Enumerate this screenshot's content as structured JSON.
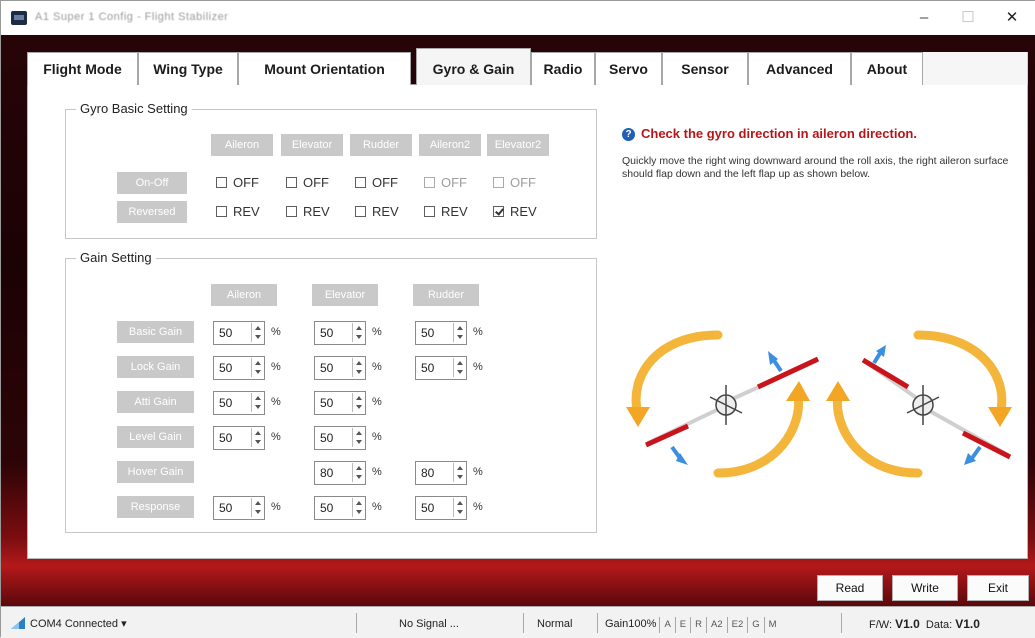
{
  "window": {
    "title": "A1 Super 1 Config - Flight Stabilizer",
    "minimize": "–",
    "maximize": "☐",
    "close": "✕"
  },
  "tabs": [
    {
      "label": "Flight Mode",
      "active": false
    },
    {
      "label": "Wing Type",
      "active": false
    },
    {
      "label": "Mount Orientation",
      "active": false
    },
    {
      "label": "Gyro & Gain",
      "active": true
    },
    {
      "label": "Radio",
      "active": false
    },
    {
      "label": "Servo",
      "active": false
    },
    {
      "label": "Sensor",
      "active": false
    },
    {
      "label": "Advanced",
      "active": false
    },
    {
      "label": "About",
      "active": false
    }
  ],
  "gyro_basic": {
    "title": "Gyro Basic Setting",
    "columns": [
      "Aileron",
      "Elevator",
      "Rudder",
      "Aileron2",
      "Elevator2"
    ],
    "onoff_label": "On-Off",
    "reversed_label": "Reversed",
    "onoff": [
      {
        "label": "OFF",
        "checked": false,
        "enabled": true
      },
      {
        "label": "OFF",
        "checked": false,
        "enabled": true
      },
      {
        "label": "OFF",
        "checked": false,
        "enabled": true
      },
      {
        "label": "OFF",
        "checked": false,
        "enabled": false
      },
      {
        "label": "OFF",
        "checked": false,
        "enabled": false
      }
    ],
    "reversed": [
      {
        "label": "REV",
        "checked": false,
        "enabled": true
      },
      {
        "label": "REV",
        "checked": false,
        "enabled": true
      },
      {
        "label": "REV",
        "checked": false,
        "enabled": true
      },
      {
        "label": "REV",
        "checked": false,
        "enabled": true
      },
      {
        "label": "REV",
        "checked": true,
        "enabled": true
      }
    ]
  },
  "gain": {
    "title": "Gain Setting",
    "columns": [
      "Aileron",
      "Elevator",
      "Rudder"
    ],
    "unit": "%",
    "rows": [
      {
        "label": "Basic Gain",
        "values": [
          "50",
          "50",
          "50"
        ]
      },
      {
        "label": "Lock Gain",
        "values": [
          "50",
          "50",
          "50"
        ]
      },
      {
        "label": "Atti Gain",
        "values": [
          "50",
          "50",
          null
        ]
      },
      {
        "label": "Level Gain",
        "values": [
          "50",
          "50",
          null
        ]
      },
      {
        "label": "Hover Gain",
        "values": [
          null,
          "80",
          "80"
        ]
      },
      {
        "label": "Response",
        "values": [
          "50",
          "50",
          "50"
        ]
      }
    ]
  },
  "info": {
    "icon": "info-icon",
    "title": "Check the gyro direction in aileron direction.",
    "description": "Quickly move the right wing downward around the roll axis, the right aileron surface should flap down and the left flap up as shown below."
  },
  "actions": {
    "read": "Read",
    "write": "Write",
    "exit": "Exit"
  },
  "status": {
    "connection": "COM4 Connected",
    "signal": "No Signal ...",
    "mode": "Normal",
    "gain_label": "Gain100%",
    "gain_chips": [
      "A",
      "E",
      "R",
      "A2",
      "E2",
      "G",
      "M"
    ],
    "fw_label": "F/W:",
    "fw_version": "V1.0",
    "data_label": "Data:",
    "data_version": "V1.0"
  },
  "colors": {
    "accent_red": "#b8151a",
    "frame_dark": "#1b0205",
    "label_grey": "#c9c9c9",
    "arrow_orange": "#f3a524",
    "arrow_blue": "#3b8fe0"
  }
}
